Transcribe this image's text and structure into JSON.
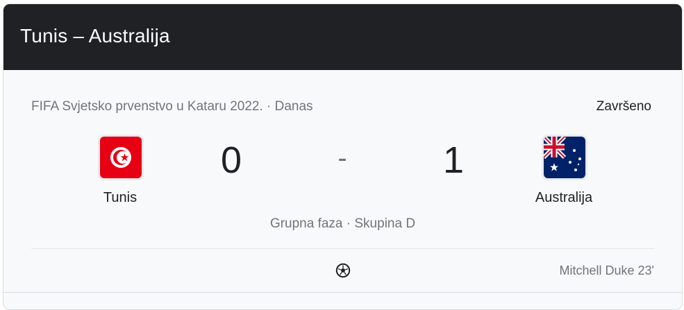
{
  "header": {
    "title": "Tunis – Australija"
  },
  "match": {
    "competition": "FIFA Svjetsko prvenstvo u Kataru 2022. · Danas",
    "status": "Završeno",
    "home": {
      "name": "Tunis",
      "score": "0",
      "flag_icon": "tunisia-flag-icon"
    },
    "away": {
      "name": "Australija",
      "score": "1",
      "flag_icon": "australia-flag-icon"
    },
    "separator": "-",
    "stage": "Grupna faza · Skupina D",
    "goals": [
      {
        "scorer": "Mitchell Duke 23'",
        "team": "away",
        "icon": "soccer-ball-icon"
      }
    ]
  },
  "colors": {
    "header_bg": "#202124",
    "card_bg": "#f8f9fa",
    "muted_text": "#70757a",
    "primary_text": "#202124"
  }
}
